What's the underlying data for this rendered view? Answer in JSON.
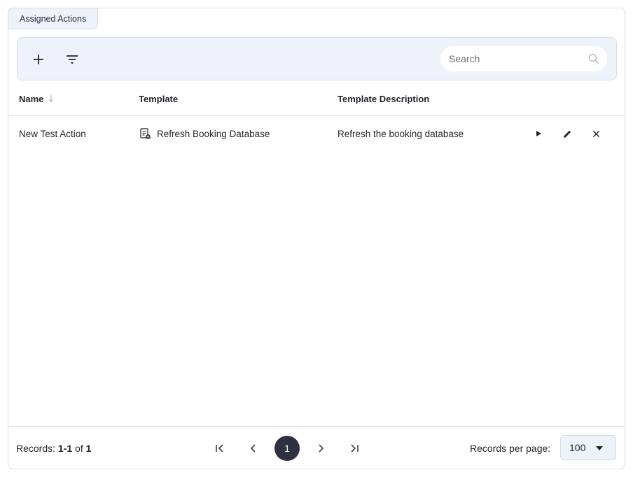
{
  "panel": {
    "tab_label": "Assigned Actions"
  },
  "toolbar": {
    "add_icon": "plus-icon",
    "filter_icon": "filter-icon",
    "search": {
      "placeholder": "Search",
      "value": "",
      "icon": "search-icon"
    }
  },
  "table": {
    "columns": {
      "name": "Name",
      "template": "Template",
      "description": "Template Description"
    },
    "sort": {
      "column": "Name",
      "direction": "descending"
    },
    "rows": [
      {
        "name": "New Test Action",
        "template": "Refresh Booking Database",
        "template_icon": "template-document-icon",
        "description": "Refresh the booking database",
        "actions": [
          "play-icon",
          "pencil-icon",
          "close-icon"
        ]
      }
    ]
  },
  "footer": {
    "records_label": "Records: ",
    "records_range": "1-1",
    "records_of": " of ",
    "records_total": "1",
    "current_page": "1",
    "pager_icons": [
      "first-page-icon",
      "prev-page-icon",
      "next-page-icon",
      "last-page-icon"
    ],
    "per_page_label": "Records per page:",
    "per_page_value": "100"
  },
  "colors": {
    "toolbar_bg": "#eef3fb",
    "border": "#dcdfe4",
    "current_page_bg": "#2e3140",
    "text": "#1f2329"
  }
}
